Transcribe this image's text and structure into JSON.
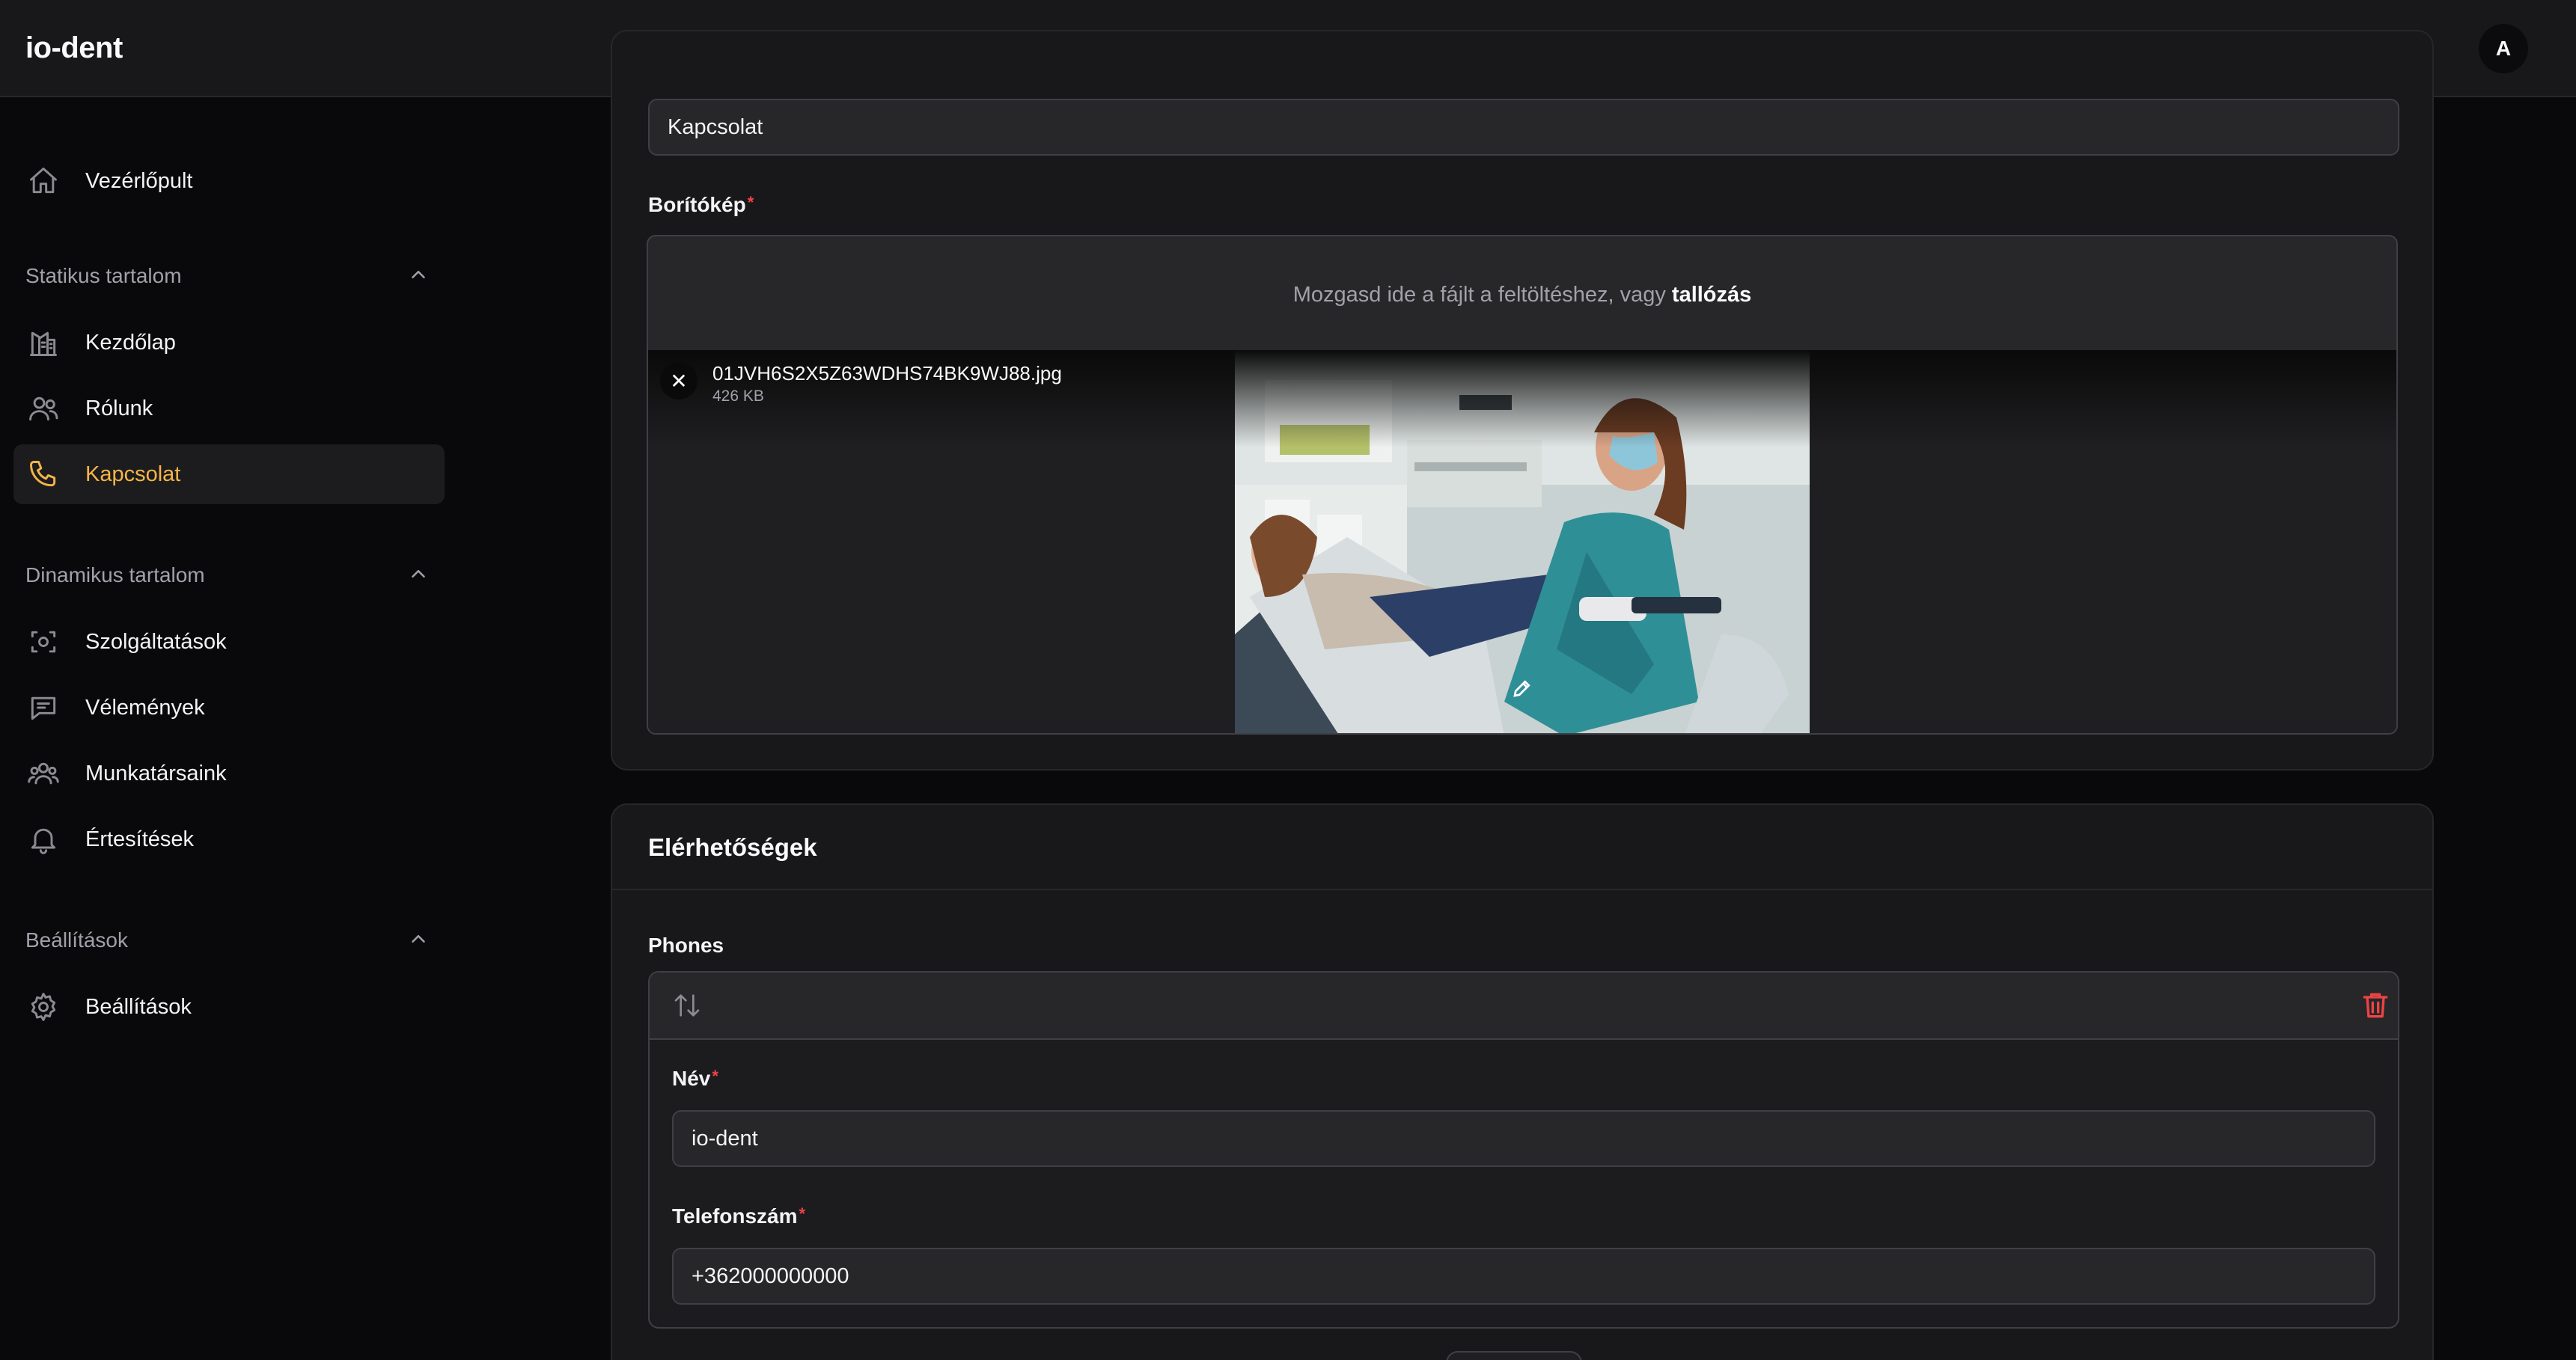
{
  "app": {
    "title": "io-dent",
    "avatar_initial": "A"
  },
  "sidebar": {
    "dashboard": "Vezérlőpult",
    "groups": [
      {
        "title": "Statikus tartalom",
        "items": [
          "Kezdőlap",
          "Rólunk",
          "Kapcsolat"
        ]
      },
      {
        "title": "Dinamikus tartalom",
        "items": [
          "Szolgáltatások",
          "Vélemények",
          "Munkatársaink",
          "Értesítések"
        ]
      },
      {
        "title": "Beállítások",
        "items": [
          "Beállítások"
        ]
      }
    ],
    "active_item": "Kapcsolat",
    "accent_color": "#f5b547"
  },
  "form": {
    "title_value": "Kapcsolat",
    "cover_label": "Borítókép",
    "required_mark": "*",
    "dropzone_text": "Mozgasd ide a fájlt a feltöltéshez, vagy",
    "dropzone_link": "tallózás",
    "file": {
      "name": "01JVH6S2X5Z63WDHS74BK9WJ88.jpg",
      "size": "426 KB"
    },
    "remove_glyph": "✕"
  },
  "contacts": {
    "section_title": "Elérhetőségek",
    "phones_label": "Phones",
    "name_label": "Név",
    "name_value": "io-dent",
    "phone_label": "Telefonszám",
    "phone_value": "+362000000000"
  }
}
